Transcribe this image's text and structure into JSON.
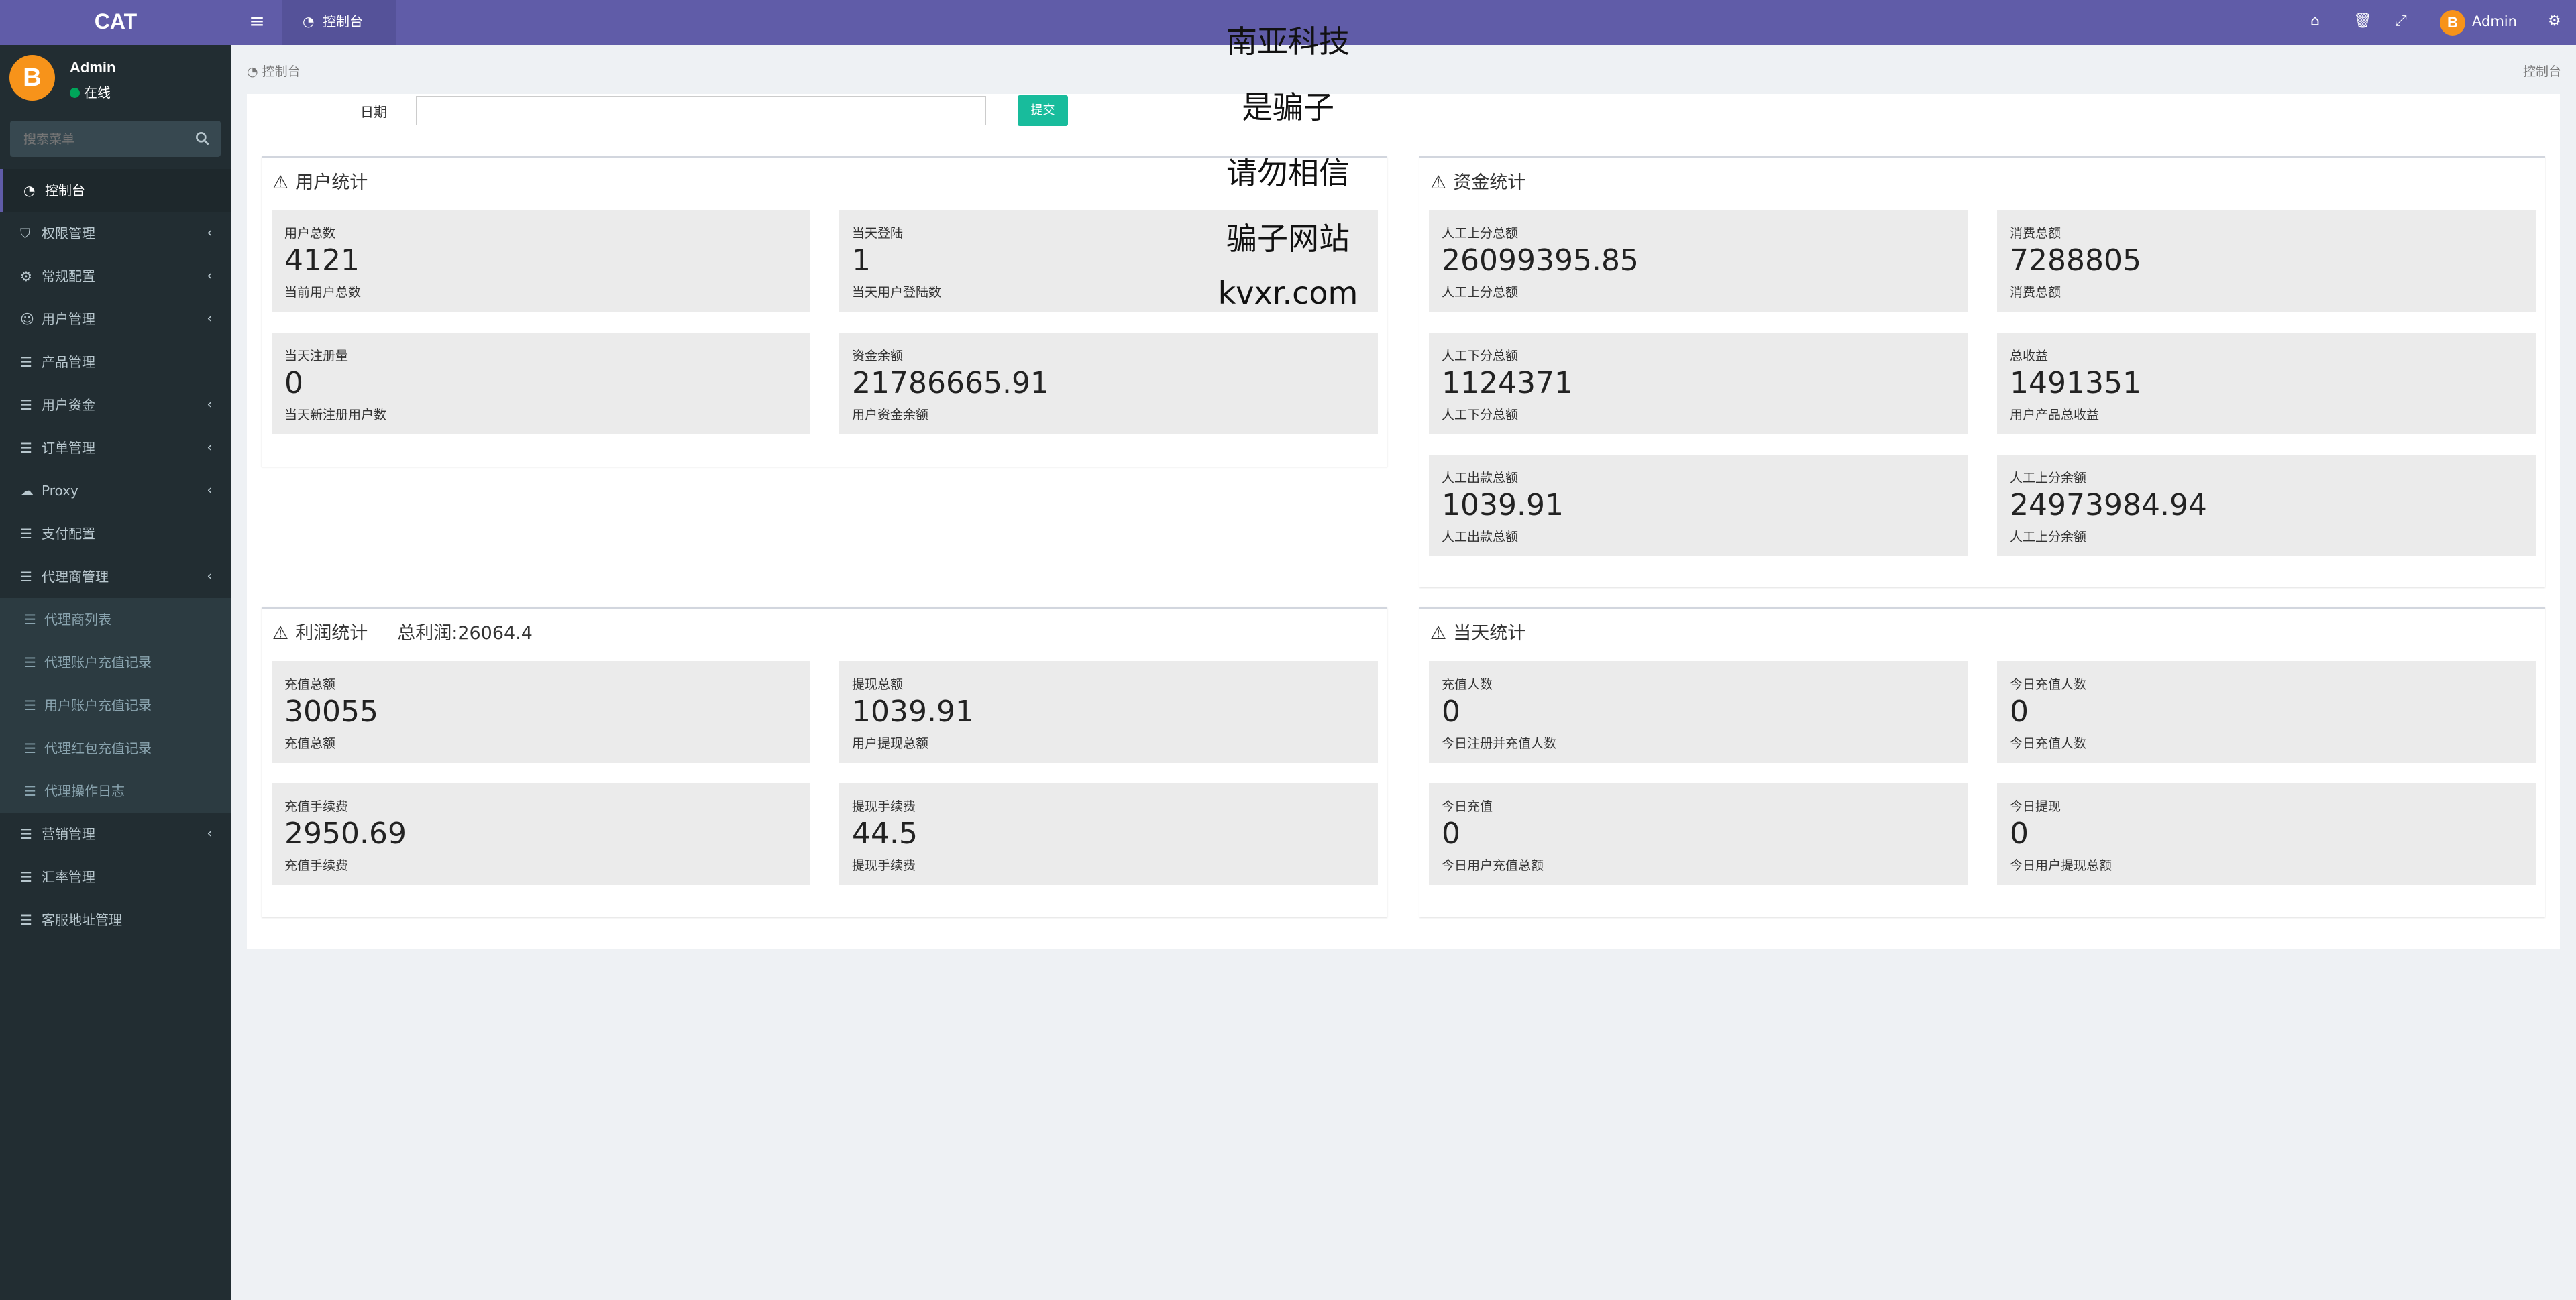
{
  "app": {
    "name": "CAT"
  },
  "user": {
    "name": "Admin",
    "status": "在线",
    "avatar_letter": "B"
  },
  "search": {
    "placeholder": "搜索菜单"
  },
  "menu": [
    {
      "label": "控制台",
      "icon": "dashboard-icon",
      "active": true
    },
    {
      "label": "权限管理",
      "icon": "shield-icon",
      "chevron": true
    },
    {
      "label": "常规配置",
      "icon": "gears-icon",
      "chevron": true
    },
    {
      "label": "用户管理",
      "icon": "user-circle-icon",
      "chevron": true
    },
    {
      "label": "产品管理",
      "icon": "list-icon"
    },
    {
      "label": "用户资金",
      "icon": "list-icon",
      "chevron": true
    },
    {
      "label": "订单管理",
      "icon": "list-icon",
      "chevron": true
    },
    {
      "label": "Proxy",
      "icon": "cloud-icon",
      "chevron": true
    },
    {
      "label": "支付配置",
      "icon": "list-icon"
    },
    {
      "label": "代理商管理",
      "icon": "list-icon",
      "expanded": true
    },
    {
      "label": "代理商列表",
      "icon": "list-icon",
      "sub": true
    },
    {
      "label": "代理账户充值记录",
      "icon": "list-icon",
      "sub": true
    },
    {
      "label": "用户账户充值记录",
      "icon": "list-icon",
      "sub": true
    },
    {
      "label": "代理红包充值记录",
      "icon": "list-icon",
      "sub": true
    },
    {
      "label": "代理操作日志",
      "icon": "list-icon",
      "sub": true
    },
    {
      "label": "营销管理",
      "icon": "list-icon",
      "chevron": true
    },
    {
      "label": "汇率管理",
      "icon": "list-icon"
    },
    {
      "label": "客服地址管理",
      "icon": "list-icon"
    }
  ],
  "topbar": {
    "tab_label": "控制台",
    "user_name": "Admin"
  },
  "breadcrumb": {
    "left": "控制台",
    "right": "控制台"
  },
  "filter": {
    "date_label": "日期",
    "date_value": "",
    "submit_label": "提交"
  },
  "watermark": [
    "南亚科技",
    "是骗子",
    "请勿相信",
    "骗子网站",
    "kvxr.com"
  ],
  "boxes": {
    "user_stats": {
      "title": "用户统计",
      "cards": [
        {
          "label": "用户总数",
          "value": "4121",
          "sub": "当前用户总数"
        },
        {
          "label": "当天登陆",
          "value": "1",
          "sub": "当天用户登陆数"
        },
        {
          "label": "当天注册量",
          "value": "0",
          "sub": "当天新注册用户数"
        },
        {
          "label": "资金余额",
          "value": "21786665.91",
          "sub": "用户资金余额"
        }
      ]
    },
    "fund_stats": {
      "title": "资金统计",
      "cards": [
        {
          "label": "人工上分总额",
          "value": "26099395.85",
          "sub": "人工上分总额"
        },
        {
          "label": "消费总额",
          "value": "7288805",
          "sub": "消费总额"
        },
        {
          "label": "人工下分总额",
          "value": "1124371",
          "sub": "人工下分总额"
        },
        {
          "label": "总收益",
          "value": "1491351",
          "sub": "用户产品总收益"
        },
        {
          "label": "人工出款总额",
          "value": "1039.91",
          "sub": "人工出款总额"
        },
        {
          "label": "人工上分余额",
          "value": "24973984.94",
          "sub": "人工上分余额"
        }
      ]
    },
    "profit_stats": {
      "title": "利润统计",
      "extra": "总利润:26064.4",
      "cards": [
        {
          "label": "充值总额",
          "value": "30055",
          "sub": "充值总额"
        },
        {
          "label": "提现总额",
          "value": "1039.91",
          "sub": "用户提现总额"
        },
        {
          "label": "充值手续费",
          "value": "2950.69",
          "sub": "充值手续费"
        },
        {
          "label": "提现手续费",
          "value": "44.5",
          "sub": "提现手续费"
        }
      ]
    },
    "today_stats": {
      "title": "当天统计",
      "cards": [
        {
          "label": "充值人数",
          "value": "0",
          "sub": "今日注册并充值人数"
        },
        {
          "label": "今日充值人数",
          "value": "0",
          "sub": "今日充值人数"
        },
        {
          "label": "今日充值",
          "value": "0",
          "sub": "今日用户充值总额"
        },
        {
          "label": "今日提现",
          "value": "0",
          "sub": "今日用户提现总额"
        }
      ]
    }
  }
}
